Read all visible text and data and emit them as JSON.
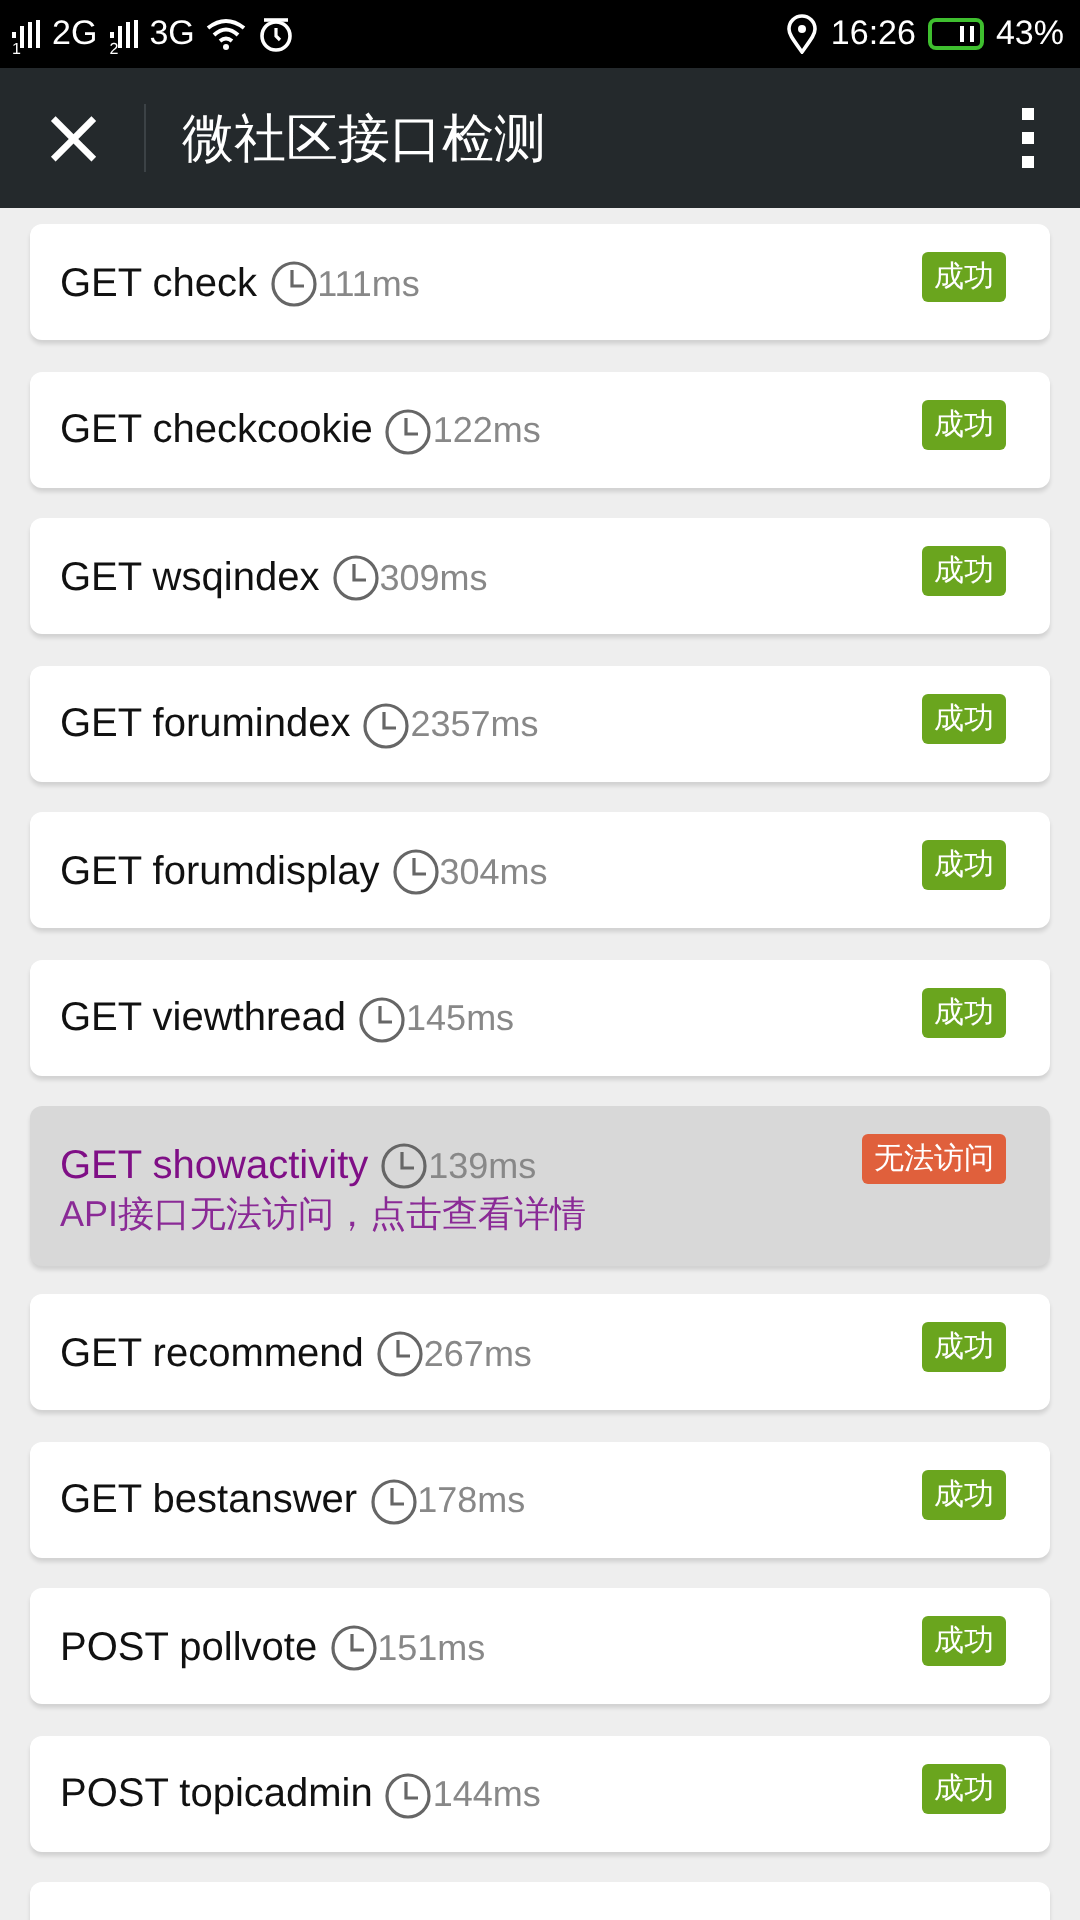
{
  "status_bar": {
    "sims": [
      {
        "slot": "1",
        "network": "2G"
      },
      {
        "slot": "2",
        "network": "3G"
      }
    ],
    "time": "16:26",
    "battery": {
      "text": "43%"
    }
  },
  "header": {
    "close": "×",
    "title": "微社区接口检测"
  },
  "rows": [
    {
      "method": "GET",
      "name": "check",
      "time": "111ms",
      "kind": "success",
      "badge": "成功"
    },
    {
      "method": "GET",
      "name": "checkcookie",
      "time": "122ms",
      "kind": "success",
      "badge": "成功"
    },
    {
      "method": "GET",
      "name": "wsqindex",
      "time": "309ms",
      "kind": "success",
      "badge": "成功"
    },
    {
      "method": "GET",
      "name": "forumindex",
      "time": "2357ms",
      "kind": "success",
      "badge": "成功"
    },
    {
      "method": "GET",
      "name": "forumdisplay",
      "time": "304ms",
      "kind": "success",
      "badge": "成功"
    },
    {
      "method": "GET",
      "name": "viewthread",
      "time": "145ms",
      "kind": "success",
      "badge": "成功"
    },
    {
      "method": "GET",
      "name": "showactivity",
      "time": "139ms",
      "kind": "fail",
      "badge": "无法访问",
      "detail": "API接口无法访问，点击查看详情"
    },
    {
      "method": "GET",
      "name": "recommend",
      "time": "267ms",
      "kind": "success",
      "badge": "成功"
    },
    {
      "method": "GET",
      "name": "bestanswer",
      "time": "178ms",
      "kind": "success",
      "badge": "成功"
    },
    {
      "method": "POST",
      "name": "pollvote",
      "time": "151ms",
      "kind": "success",
      "badge": "成功"
    },
    {
      "method": "POST",
      "name": "topicadmin",
      "time": "144ms",
      "kind": "success",
      "badge": "成功"
    }
  ]
}
